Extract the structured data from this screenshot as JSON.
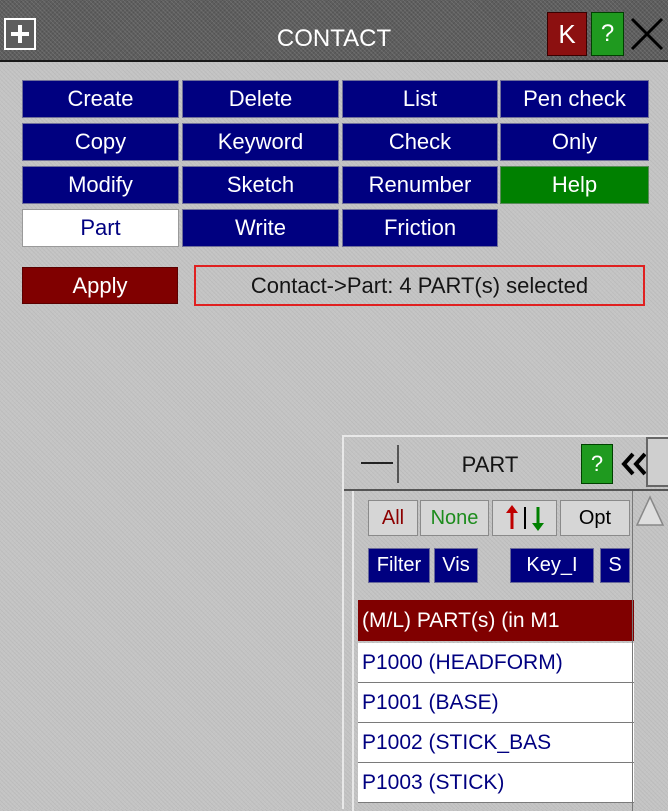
{
  "window": {
    "title": "CONTACT",
    "k_label": "K",
    "help_label": "?",
    "colors": {
      "navy": "#000080",
      "green": "#008000",
      "dark_red": "#800000",
      "background": "#c4c4c4"
    }
  },
  "buttons": {
    "create": "Create",
    "delete": "Delete",
    "list": "List",
    "pen_check": "Pen check",
    "copy": "Copy",
    "keyword": "Keyword",
    "check": "Check",
    "only": "Only",
    "modify": "Modify",
    "sketch": "Sketch",
    "renumber": "Renumber",
    "help": "Help",
    "part": "Part",
    "write": "Write",
    "friction": "Friction"
  },
  "apply": {
    "label": "Apply",
    "status": "Contact->Part: 4 PART(s) selected"
  },
  "part_panel": {
    "title": "PART",
    "help_label": "?",
    "buttons": {
      "all": "All",
      "none": "None",
      "sort": "↑↓",
      "opt": "Opt",
      "filter": "Filter",
      "vis": "Vis",
      "key": "Key_I",
      "s": "S"
    },
    "list_header": "(M/L) PART(s) (in M1",
    "items": [
      "P1000 (HEADFORM)",
      "P1001 (BASE)",
      "P1002 (STICK_BAS",
      "P1003 (STICK)"
    ]
  }
}
